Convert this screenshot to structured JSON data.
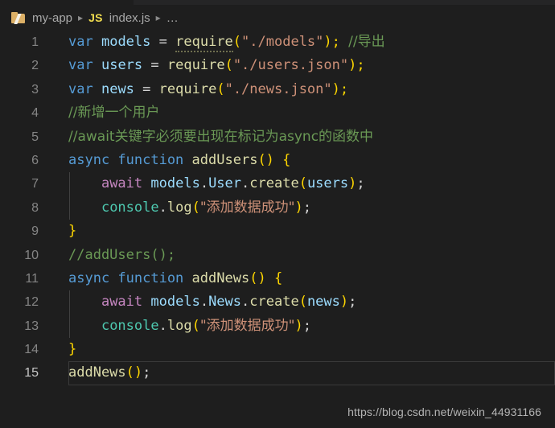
{
  "breadcrumb": {
    "folder_icon": "folder-icon",
    "project": "my-app",
    "separator": "▸",
    "file_badge": "JS",
    "file": "index.js",
    "overflow": "…"
  },
  "editor": {
    "language": "javascript",
    "current_line": 15,
    "lines": [
      {
        "number": "1",
        "text": "var models = require(\"./models\"); //导出"
      },
      {
        "number": "2",
        "text": "var users = require(\"./users.json\");"
      },
      {
        "number": "3",
        "text": "var news = require(\"./news.json\");"
      },
      {
        "number": "4",
        "text": "//新增一个用户"
      },
      {
        "number": "5",
        "text": "//await关键字必须要出现在标记为async的函数中"
      },
      {
        "number": "6",
        "text": "async function addUsers() {"
      },
      {
        "number": "7",
        "text": "    await models.User.create(users);"
      },
      {
        "number": "8",
        "text": "    console.log(\"添加数据成功\");"
      },
      {
        "number": "9",
        "text": "}"
      },
      {
        "number": "10",
        "text": "//addUsers();"
      },
      {
        "number": "11",
        "text": "async function addNews() {"
      },
      {
        "number": "12",
        "text": "    await models.News.create(news);"
      },
      {
        "number": "13",
        "text": "    console.log(\"添加数据成功\");"
      },
      {
        "number": "14",
        "text": "}"
      },
      {
        "number": "15",
        "text": "addNews();"
      }
    ],
    "tokens": {
      "l1": {
        "kw": "var",
        "name": "models",
        "eq": "=",
        "fn": "require",
        "str": "\"./models\"",
        "end": ");",
        "cmt": "//导出",
        "open": "("
      },
      "l2": {
        "kw": "var",
        "name": "users",
        "eq": "=",
        "fn": "require",
        "str": "\"./users.json\"",
        "open": "(",
        "end": ");"
      },
      "l3": {
        "kw": "var",
        "name": "news",
        "eq": "=",
        "fn": "require",
        "str": "\"./news.json\"",
        "open": "(",
        "end": ");"
      },
      "l4": {
        "cmt": "//新增一个用户"
      },
      "l5": {
        "cmt": "//await关键字必须要出现在标记为async的函数中"
      },
      "l6": {
        "kw": "async function",
        "name": "addUsers",
        "parens": "()",
        "brace": "{"
      },
      "l7": {
        "ctrl": "await",
        "obj": "models",
        "prop": "User",
        "fn": "create",
        "arg": "users",
        "end": ";"
      },
      "l8": {
        "cls": "console",
        "fn": "log",
        "str": "\"添加数据成功\"",
        "end": ";"
      },
      "l9": {
        "brace": "}"
      },
      "l10": {
        "cmt": "//addUsers();"
      },
      "l11": {
        "kw": "async function",
        "name": "addNews",
        "parens": "()",
        "brace": "{"
      },
      "l12": {
        "ctrl": "await",
        "obj": "models",
        "prop": "News",
        "fn": "create",
        "arg": "news",
        "end": ";"
      },
      "l13": {
        "cls": "console",
        "fn": "log",
        "str": "\"添加数据成功\"",
        "end": ";"
      },
      "l14": {
        "brace": "}"
      },
      "l15": {
        "fn": "addNews",
        "parens": "()",
        "end": ";"
      }
    }
  },
  "watermark": {
    "url": "https://blog.csdn.net/weixin_44931166"
  },
  "colors": {
    "background": "#1e1e1e",
    "keyword": "#569cd6",
    "control": "#c586c0",
    "variable": "#9cdcfe",
    "function": "#dcdcaa",
    "string": "#ce9178",
    "comment": "#6a9955",
    "class": "#4ec9b0",
    "plain": "#d4d4d4",
    "line_number": "#858585",
    "js_badge": "#f0dc4e",
    "folder_icon": "#dcb067"
  }
}
